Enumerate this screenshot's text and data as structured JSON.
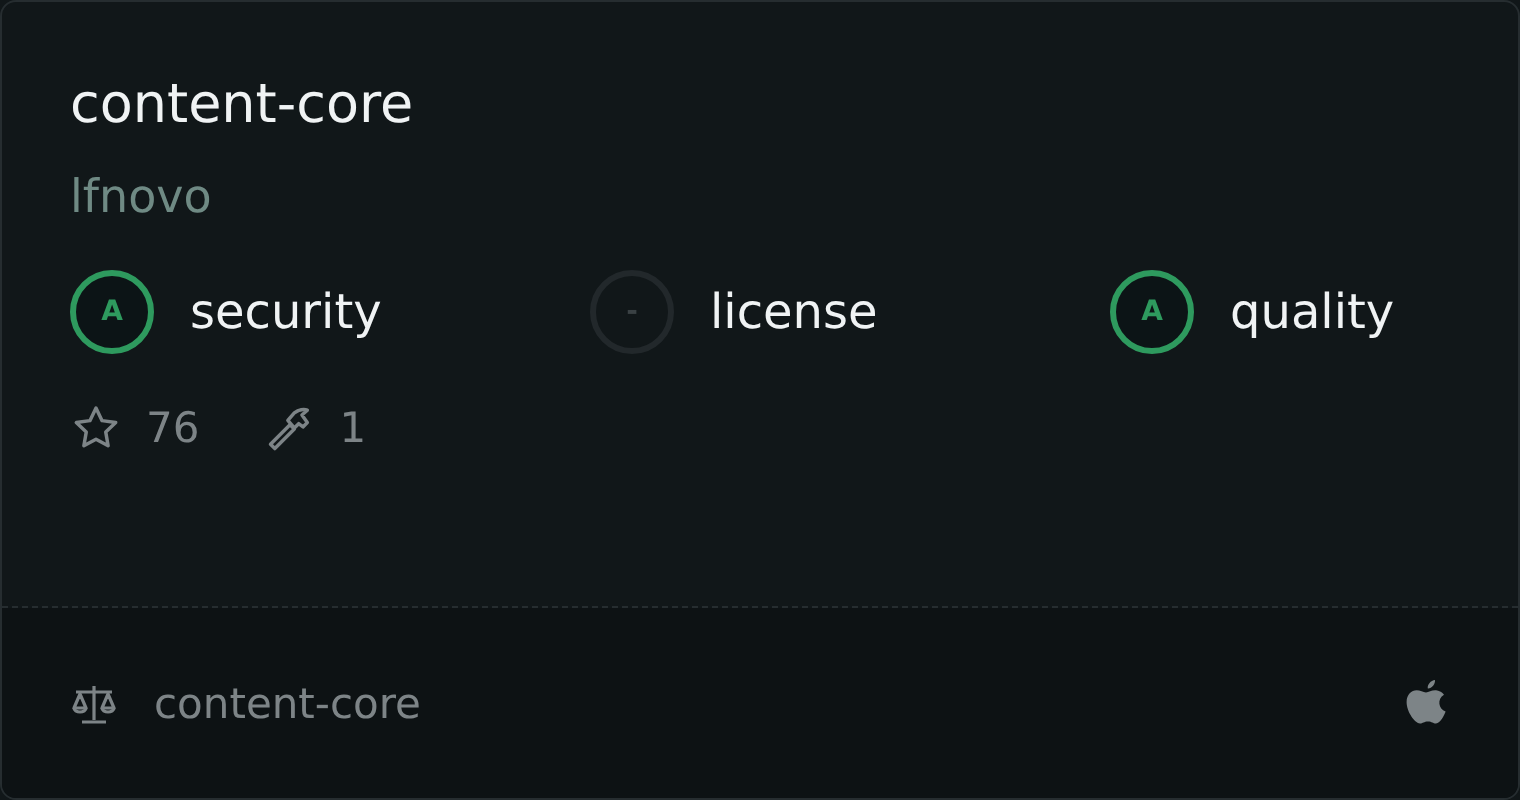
{
  "title": "content-core",
  "owner": "lfnovo",
  "scores": [
    {
      "kind": "graded",
      "grade": "A",
      "label": "security"
    },
    {
      "kind": "none",
      "grade": "-",
      "label": "license"
    },
    {
      "kind": "graded",
      "grade": "A",
      "label": "quality"
    }
  ],
  "stats": {
    "stars": "76",
    "forks": "1"
  },
  "footer": {
    "license": "content-core"
  }
}
